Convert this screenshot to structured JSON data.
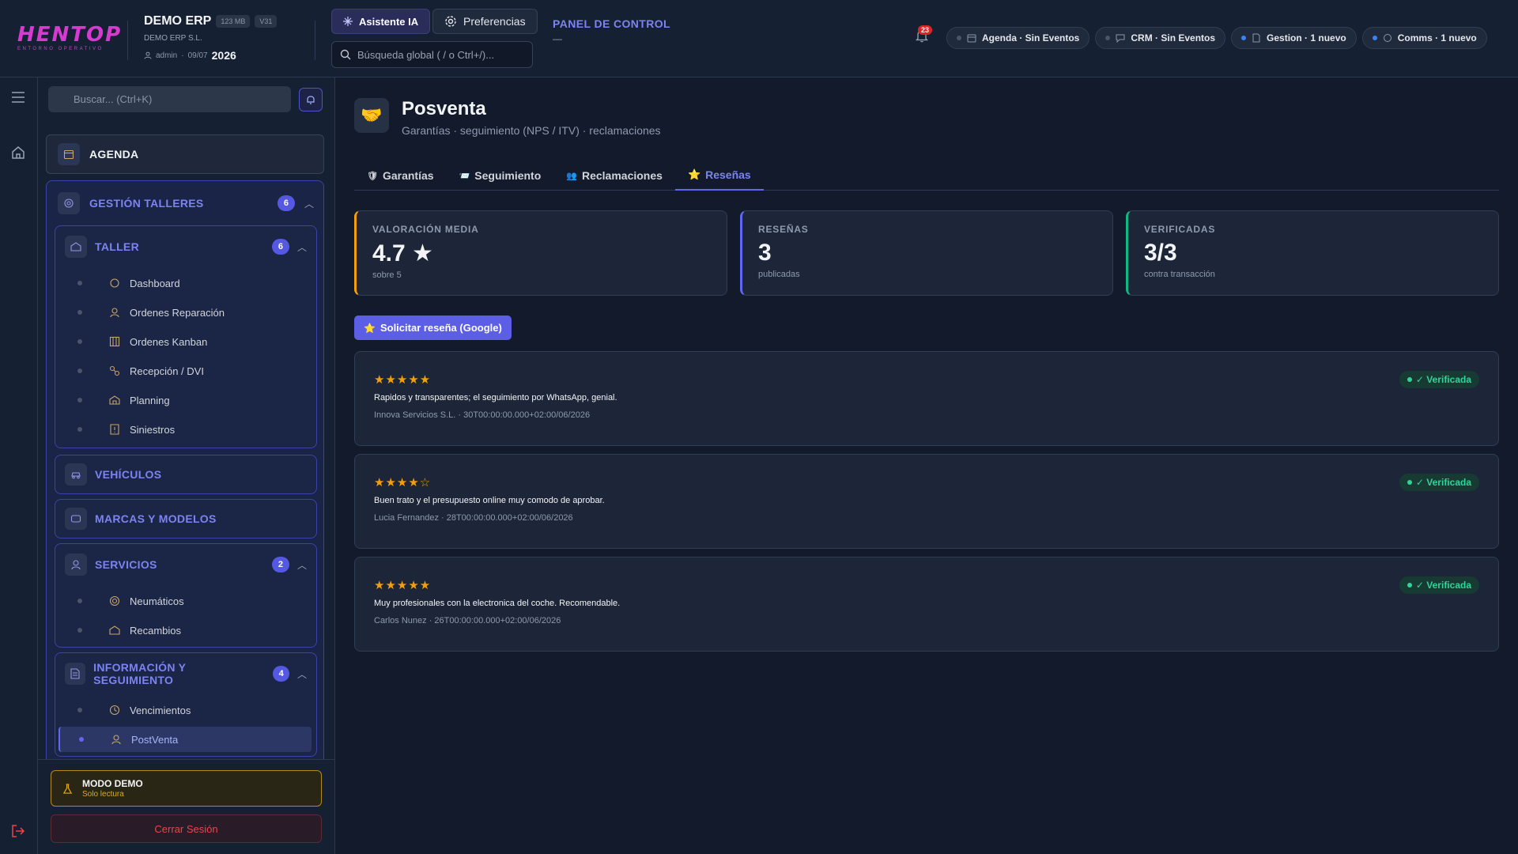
{
  "header": {
    "logo_text": "HENTOP",
    "logo_sub": "ENTORNO OPERATIVO",
    "company_name": "DEMO ERP",
    "memory": "123 MB",
    "version": "V31",
    "company_legal": "DEMO ERP S.L.",
    "user": "admin",
    "date": "09/07",
    "year": "2026",
    "ai_button": "Asistente IA",
    "prefs_button": "Preferencias",
    "search_placeholder": "Búsqueda global ( / o Ctrl+/)...",
    "panel_title": "PANEL DE CONTROL",
    "panel_dash": "—",
    "notifications_count": "23",
    "pills": [
      {
        "label": "Agenda · Sin Eventos",
        "dot": "#4b5468"
      },
      {
        "label": "CRM · Sin Eventos",
        "dot": "#4b5468"
      },
      {
        "label": "Gestion · 1 nuevo",
        "dot": "#3b82f6"
      },
      {
        "label": "Comms · 1 nuevo",
        "dot": "#3b82f6"
      }
    ]
  },
  "sidebar": {
    "search_placeholder": "Buscar... (Ctrl+K)",
    "agenda": "AGENDA",
    "group": {
      "label": "GESTIÓN TALLERES",
      "count": "6"
    },
    "taller": {
      "label": "TALLER",
      "count": "6",
      "items": [
        "Dashboard",
        "Ordenes Reparación",
        "Ordenes Kanban",
        "Recepción / DVI",
        "Planning",
        "Siniestros"
      ]
    },
    "vehiculos": "VEHÍCULOS",
    "marcas": "MARCAS Y MODELOS",
    "servicios": {
      "label": "SERVICIOS",
      "count": "2",
      "items": [
        "Neumáticos",
        "Recambios"
      ]
    },
    "info": {
      "label": "INFORMACIÓN Y SEGUIMIENTO",
      "count": "4",
      "items": [
        "Vencimientos",
        "PostVenta"
      ]
    },
    "demo_title": "MODO DEMO",
    "demo_sub": "Solo lectura",
    "logout": "Cerrar Sesión"
  },
  "main": {
    "title": "Posventa",
    "subtitle": "Garantías · seguimiento (NPS / ITV) · reclamaciones",
    "tabs": [
      {
        "icon": "🛡",
        "label": "Garantías"
      },
      {
        "icon": "📨",
        "label": "Seguimiento"
      },
      {
        "icon": "👥",
        "label": "Reclamaciones"
      },
      {
        "icon": "⭐",
        "label": "Reseñas"
      }
    ],
    "kpis": [
      {
        "label": "VALORACIÓN MEDIA",
        "value": "4.7 ★",
        "sub": "sobre 5",
        "color": "#f59e0b"
      },
      {
        "label": "RESEÑAS",
        "value": "3",
        "sub": "publicadas",
        "color": "#6366f1"
      },
      {
        "label": "VERIFICADAS",
        "value": "3/3",
        "sub": "contra transacción",
        "color": "#10b981"
      }
    ],
    "request_button": "Solicitar reseña (Google)",
    "reviews": [
      {
        "stars": "★★★★★",
        "text": "Rapidos y transparentes; el seguimiento por WhatsApp, genial.",
        "meta": "Innova Servicios S.L. · 30T00:00:00.000+02:00/06/2026",
        "badge": "✓ Verificada"
      },
      {
        "stars": "★★★★☆",
        "text": "Buen trato y el presupuesto online muy comodo de aprobar.",
        "meta": "Lucia Fernandez · 28T00:00:00.000+02:00/06/2026",
        "badge": "✓ Verificada"
      },
      {
        "stars": "★★★★★",
        "text": "Muy profesionales con la electronica del coche. Recomendable.",
        "meta": "Carlos Nunez · 26T00:00:00.000+02:00/06/2026",
        "badge": "✓ Verificada"
      }
    ]
  },
  "colors": {
    "accent": "#6366f1",
    "warning": "#f59e0b",
    "success": "#10b981",
    "danger": "#ef4444"
  }
}
